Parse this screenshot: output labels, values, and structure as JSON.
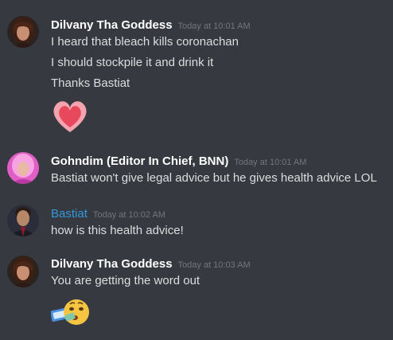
{
  "messages": [
    {
      "author": "Dilvany Tha Goddess",
      "author_color": "#ffffff",
      "timestamp": "Today at 10:01 AM",
      "avatar": "woman-avatar",
      "lines": [
        "I heard that bleach kills coronachan",
        "I should stockpile it and drink it",
        "Thanks Bastiat"
      ],
      "emoji": "heartpulse-emoji"
    },
    {
      "author": "Gohndim (Editor In Chief, BNN)",
      "author_color": "#ffffff",
      "timestamp": "Today at 10:01 AM",
      "avatar": "pink-hair-avatar",
      "lines": [
        "Bastiat won't give legal advice but he gives health advice LOL"
      ]
    },
    {
      "author": "Bastiat",
      "author_color": "#3498db",
      "timestamp": "Today at 10:02 AM",
      "avatar": "man-suit-avatar",
      "lines": [
        "how is this health advice!"
      ]
    },
    {
      "author": "Dilvany Tha Goddess",
      "author_color": "#ffffff",
      "timestamp": "Today at 10:03 AM",
      "avatar": "woman-avatar",
      "lines": [
        "You are getting the word out"
      ],
      "emoji": "money-face-emoji"
    }
  ]
}
